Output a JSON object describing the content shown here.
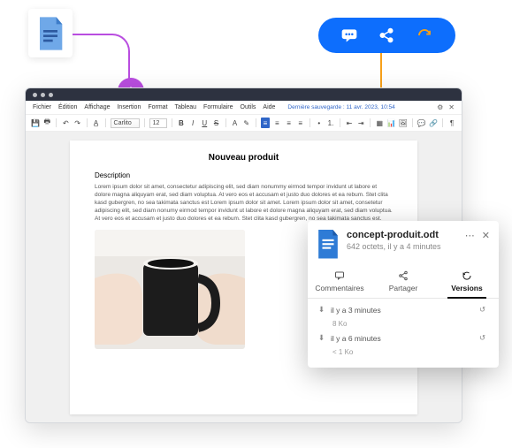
{
  "pill": {
    "icons": [
      "comment",
      "share",
      "refresh"
    ]
  },
  "menubar": {
    "items": [
      "Fichier",
      "Édition",
      "Affichage",
      "Insertion",
      "Format",
      "Tableau",
      "Formulaire",
      "Outils",
      "Aide"
    ],
    "save_info": "Dernière sauvegarde : 11 avr. 2023, 10:54"
  },
  "toolbar": {
    "font": "Carlito",
    "size": "12"
  },
  "document": {
    "title": "Nouveau produit",
    "section": "Description",
    "para": "Lorem ipsum dolor sit amet, consectetur adipiscing elit, sed diam nonummy eirmod tempor invidunt ut labore et dolore magna aliquyam erat, sed diam voluptua. At vero eos et accusam et justo duo dolores et ea rebum. Stet clita kasd gubergren, no sea takimata sanctus est Lorem ipsum dolor sit amet. Lorem ipsum dolor sit amet, consetetur adipiscing elit, sed diam nonumy eirmod tempor invidunt ut labore et dolore magna aliquyam erat, sed diam voluptua. At vero eos et accusam et justo duo dolores et ea rebum. Stet clita kasd gubergren, no sea takimata sanctus est."
  },
  "popover": {
    "filename": "concept-produit.odt",
    "meta": "642 octets, il y a 4 minutes",
    "tabs": {
      "comments": "Commentaires",
      "share": "Partager",
      "versions": "Versions"
    },
    "versions": [
      {
        "ago": "il y a 3 minutes",
        "size": "8 Ko"
      },
      {
        "ago": "il y a 6 minutes",
        "size": "< 1 Ko"
      }
    ]
  }
}
